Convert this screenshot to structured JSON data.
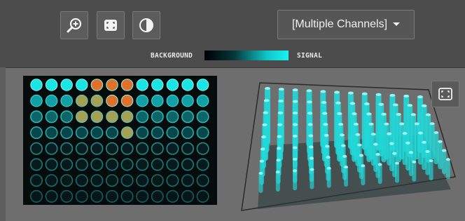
{
  "toolbar": {
    "tools": [
      {
        "name": "zoom-in-icon"
      },
      {
        "name": "fit-frame-icon"
      },
      {
        "name": "contrast-icon"
      }
    ],
    "channel_dropdown": {
      "selected": "[Multiple Channels]",
      "icon": "caret-down-icon"
    }
  },
  "legend": {
    "low_label": "BACKGROUND",
    "high_label": "SIGNAL",
    "colors": [
      "#000000",
      "#19f2f2"
    ]
  },
  "plate": {
    "rows": 8,
    "columns": 12,
    "well_colors": {
      "signal": "#19e5e5",
      "hot": "#e0702a",
      "mixed": "#b8b25a",
      "dim_ring": "#1f8a8e"
    }
  },
  "view3d": {
    "fit_button_icon": "fit-frame-icon",
    "bar_color": "#22d8d8"
  }
}
